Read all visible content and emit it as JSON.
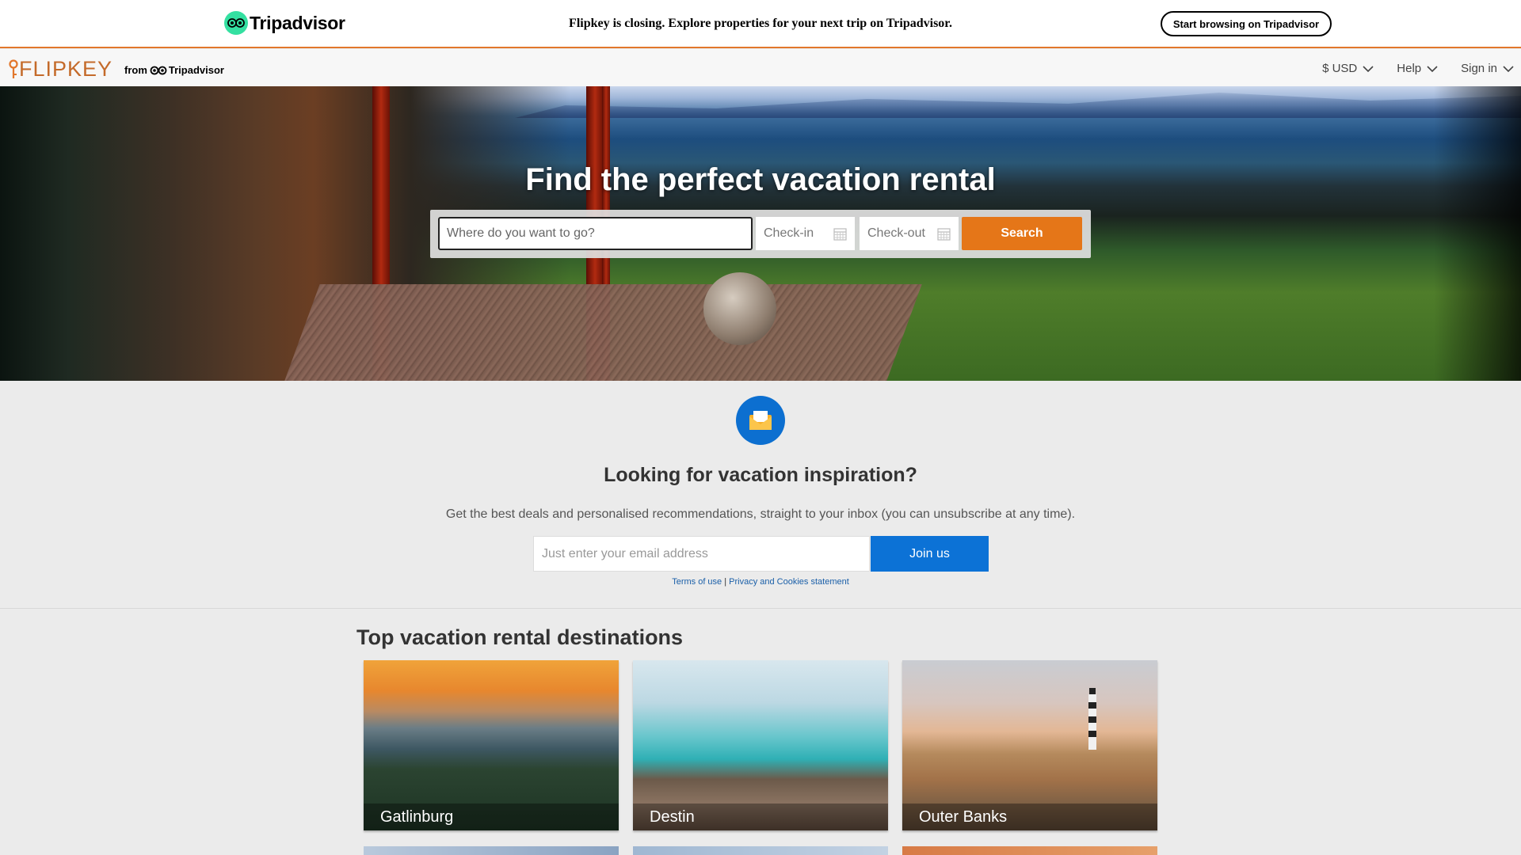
{
  "ta_banner": {
    "logo_text": "Tripadvisor",
    "message": "Flipkey is closing. Explore properties for your next trip on Tripadvisor.",
    "cta_label": "Start browsing on Tripadvisor"
  },
  "nav": {
    "logo_text": "FLIPKEY",
    "from_label": "from",
    "from_brand": "Tripadvisor",
    "currency": "$ USD",
    "help": "Help",
    "sign_in": "Sign in"
  },
  "hero": {
    "title": "Find the perfect vacation rental",
    "where_placeholder": "Where do you want to go?",
    "checkin_label": "Check-in",
    "checkout_label": "Check-out",
    "search_label": "Search"
  },
  "newsletter": {
    "title": "Looking for vacation inspiration?",
    "subtitle": "Get the best deals and personalised recommendations, straight to your inbox (you can unsubscribe at any time).",
    "email_placeholder": "Just enter your email address",
    "join_label": "Join us",
    "terms_label": "Terms of use",
    "separator": "|",
    "privacy_label": "Privacy and Cookies statement"
  },
  "destinations": {
    "title": "Top vacation rental destinations",
    "items": [
      {
        "name": "Gatlinburg"
      },
      {
        "name": "Destin"
      },
      {
        "name": "Outer Banks"
      }
    ]
  },
  "colors": {
    "accent_orange": "#e57618",
    "accent_blue": "#0c72d6",
    "tripadvisor_green": "#34e0a1"
  }
}
